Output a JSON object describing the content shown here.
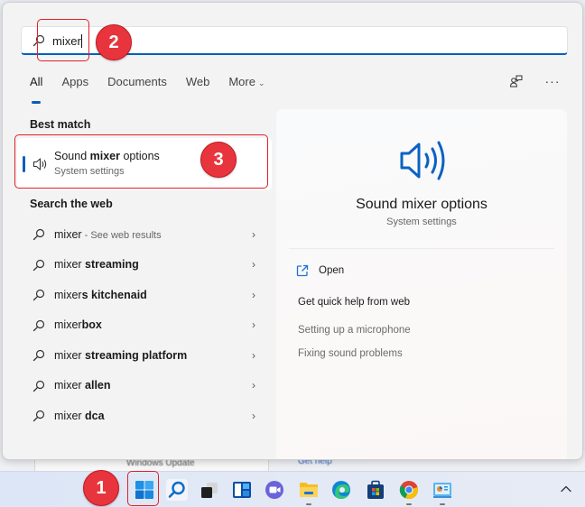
{
  "search": {
    "query": "mixer"
  },
  "tabs": [
    {
      "label": "All",
      "active": true
    },
    {
      "label": "Apps",
      "active": false
    },
    {
      "label": "Documents",
      "active": false
    },
    {
      "label": "Web",
      "active": false
    },
    {
      "label": "More",
      "active": false
    }
  ],
  "toolbar": {
    "feedback_icon": "feedback-icon",
    "more_icon": "more-options-icon"
  },
  "best_match": {
    "section_label": "Best match",
    "title_pre": "Sound ",
    "title_bold": "mixer",
    "title_post": " options",
    "subtitle": "System settings",
    "icon": "speaker-icon"
  },
  "web_search": {
    "section_label": "Search the web",
    "items": [
      {
        "prefix": "mixer",
        "bold": "",
        "suffix": " - See web results"
      },
      {
        "prefix": "mixer",
        "bold": " streaming",
        "suffix": ""
      },
      {
        "prefix": "mixer",
        "bold": "s kitchenaid",
        "suffix": ""
      },
      {
        "prefix": "mixer",
        "bold": "box",
        "suffix": ""
      },
      {
        "prefix": "mixer",
        "bold": " streaming platform",
        "suffix": ""
      },
      {
        "prefix": "mixer",
        "bold": " allen",
        "suffix": ""
      },
      {
        "prefix": "mixer",
        "bold": " dca",
        "suffix": ""
      }
    ]
  },
  "preview": {
    "title": "Sound mixer options",
    "subtitle": "System settings",
    "open_label": "Open",
    "help_title": "Get quick help from web",
    "help_links": [
      "Setting up a microphone",
      "Fixing sound problems"
    ]
  },
  "background": {
    "window_text": "Windows Update",
    "window_text2": "Get help"
  },
  "annotations": [
    "1",
    "2",
    "3"
  ],
  "taskbar": {
    "items": [
      {
        "name": "start-button",
        "icon": "windows-logo-icon"
      },
      {
        "name": "search-button",
        "icon": "search-icon"
      },
      {
        "name": "task-view-button",
        "icon": "task-view-icon"
      },
      {
        "name": "widgets-button",
        "icon": "widgets-icon"
      },
      {
        "name": "teams-chat-button",
        "icon": "teams-chat-icon"
      },
      {
        "name": "file-explorer-button",
        "icon": "folder-icon"
      },
      {
        "name": "edge-button",
        "icon": "edge-icon"
      },
      {
        "name": "store-button",
        "icon": "store-icon"
      },
      {
        "name": "chrome-button",
        "icon": "chrome-icon"
      },
      {
        "name": "control-panel-button",
        "icon": "control-panel-icon"
      }
    ],
    "tray_chevron": "chevron-up-icon"
  },
  "colors": {
    "accent": "#005fb8",
    "annotation": "#e8353d"
  }
}
